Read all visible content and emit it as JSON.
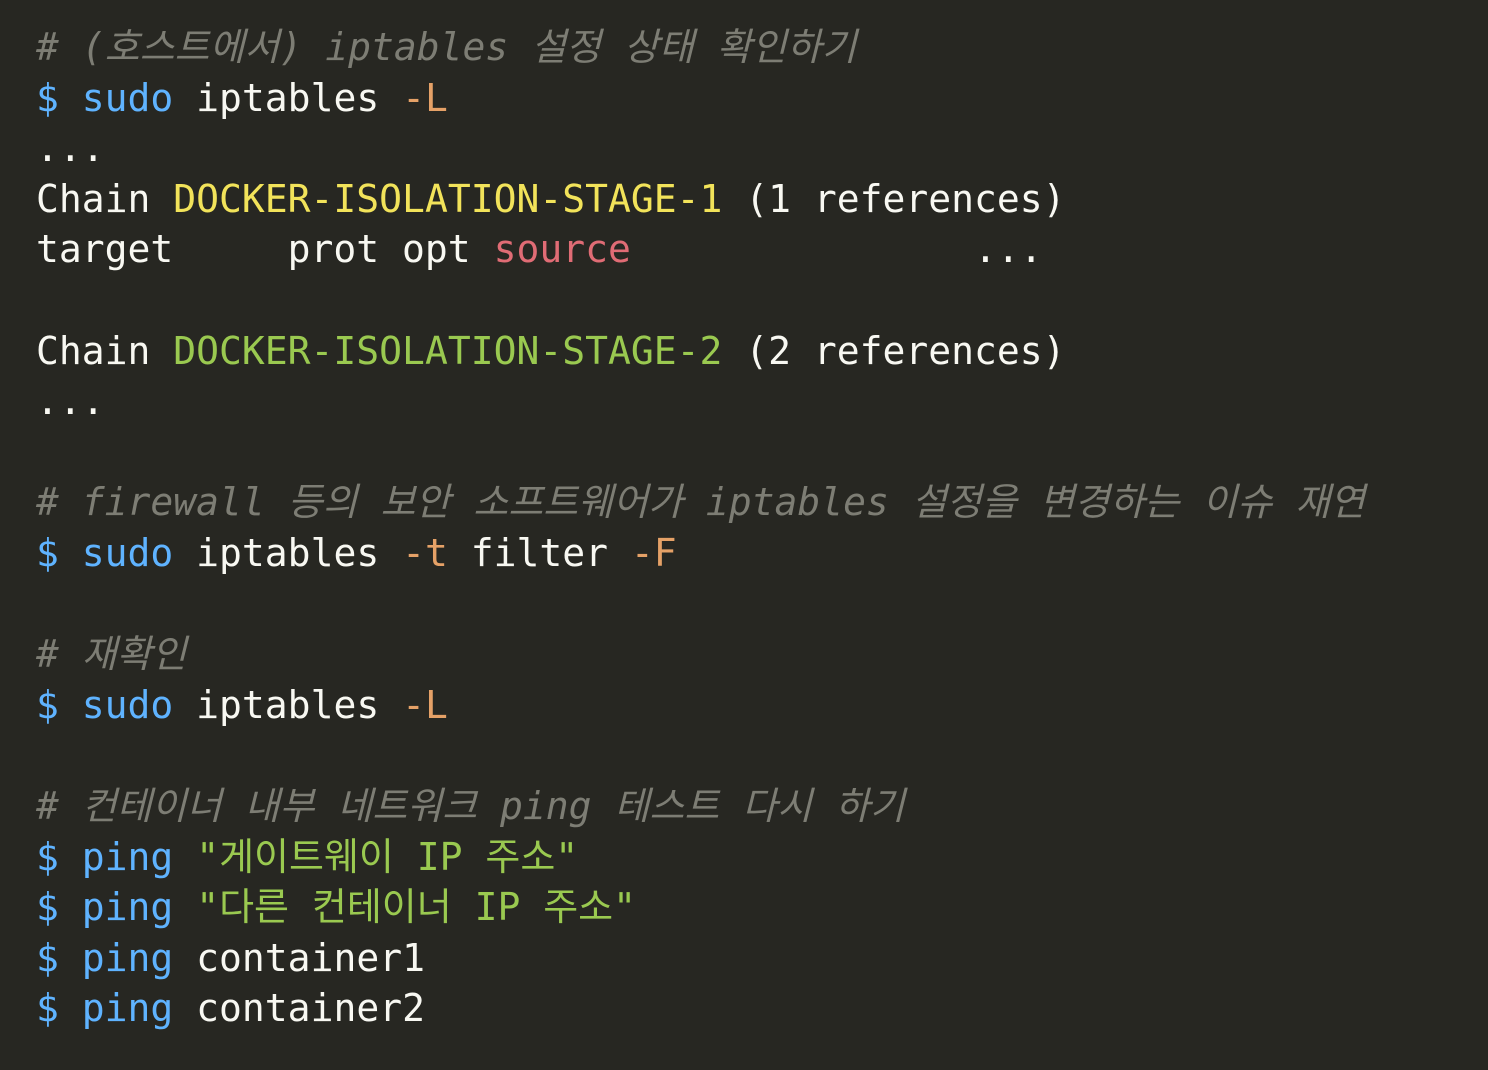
{
  "colors": {
    "background": "#272722",
    "comment": "#7d7d74",
    "prompt": "#5fb3ff",
    "command": "#5fb3ff",
    "text": "#f8f8f2",
    "flag": "#e5a167",
    "chain_stage_1": "#f2e35a",
    "chain_stage_2": "#9ac950",
    "source": "#e06c75",
    "string": "#9ac950"
  },
  "lines": [
    [
      {
        "t": "comment",
        "v": "# (호스트에서) iptables 설정 상태 확인하기"
      }
    ],
    [
      {
        "t": "prompt",
        "v": "$"
      },
      {
        "t": "plain",
        "v": " "
      },
      {
        "t": "cmd",
        "v": "sudo"
      },
      {
        "t": "plain",
        "v": " iptables "
      },
      {
        "t": "flag",
        "v": "-L"
      }
    ],
    [
      {
        "t": "plain",
        "v": "..."
      }
    ],
    [
      {
        "t": "plain",
        "v": "Chain "
      },
      {
        "t": "chain1",
        "v": "DOCKER-ISOLATION-STAGE-1"
      },
      {
        "t": "plain",
        "v": " (1 references)"
      }
    ],
    [
      {
        "t": "plain",
        "v": "target     prot opt "
      },
      {
        "t": "source",
        "v": "source"
      },
      {
        "t": "plain",
        "v": "               ..."
      }
    ],
    [],
    [
      {
        "t": "plain",
        "v": "Chain "
      },
      {
        "t": "chain2",
        "v": "DOCKER-ISOLATION-STAGE-2"
      },
      {
        "t": "plain",
        "v": " (2 references)"
      }
    ],
    [
      {
        "t": "plain",
        "v": "..."
      }
    ],
    [],
    [
      {
        "t": "comment",
        "v": "# firewall 등의 보안 소프트웨어가 iptables 설정을 변경하는 이슈 재연"
      }
    ],
    [
      {
        "t": "prompt",
        "v": "$"
      },
      {
        "t": "plain",
        "v": " "
      },
      {
        "t": "cmd",
        "v": "sudo"
      },
      {
        "t": "plain",
        "v": " iptables "
      },
      {
        "t": "flag",
        "v": "-t"
      },
      {
        "t": "plain",
        "v": " filter "
      },
      {
        "t": "flag",
        "v": "-F"
      }
    ],
    [],
    [
      {
        "t": "comment",
        "v": "# 재확인"
      }
    ],
    [
      {
        "t": "prompt",
        "v": "$"
      },
      {
        "t": "plain",
        "v": " "
      },
      {
        "t": "cmd",
        "v": "sudo"
      },
      {
        "t": "plain",
        "v": " iptables "
      },
      {
        "t": "flag",
        "v": "-L"
      }
    ],
    [],
    [
      {
        "t": "comment",
        "v": "# 컨테이너 내부 네트워크 ping 테스트 다시 하기"
      }
    ],
    [
      {
        "t": "prompt",
        "v": "$"
      },
      {
        "t": "plain",
        "v": " "
      },
      {
        "t": "cmd",
        "v": "ping"
      },
      {
        "t": "plain",
        "v": " "
      },
      {
        "t": "string",
        "v": "\"게이트웨이 IP 주소\""
      }
    ],
    [
      {
        "t": "prompt",
        "v": "$"
      },
      {
        "t": "plain",
        "v": " "
      },
      {
        "t": "cmd",
        "v": "ping"
      },
      {
        "t": "plain",
        "v": " "
      },
      {
        "t": "string",
        "v": "\"다른 컨테이너 IP 주소\""
      }
    ],
    [
      {
        "t": "prompt",
        "v": "$"
      },
      {
        "t": "plain",
        "v": " "
      },
      {
        "t": "cmd",
        "v": "ping"
      },
      {
        "t": "plain",
        "v": " container1"
      }
    ],
    [
      {
        "t": "prompt",
        "v": "$"
      },
      {
        "t": "plain",
        "v": " "
      },
      {
        "t": "cmd",
        "v": "ping"
      },
      {
        "t": "plain",
        "v": " container2"
      }
    ]
  ]
}
